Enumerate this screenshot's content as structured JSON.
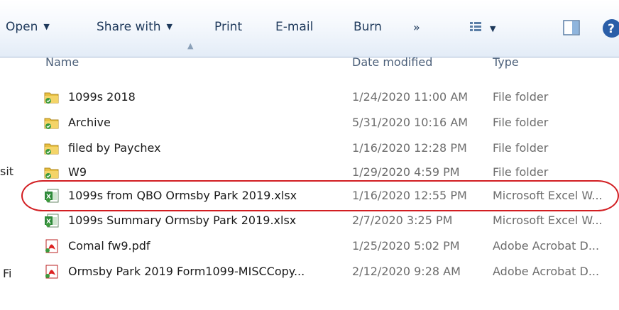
{
  "toolbar": {
    "open": "Open",
    "share": "Share with",
    "print": "Print",
    "email": "E-mail",
    "burn": "Burn",
    "more": "»"
  },
  "nav": {
    "frag1": "sit",
    "frag2": "Fi"
  },
  "columns": {
    "name": "Name",
    "date": "Date modified",
    "type": "Type"
  },
  "files": [
    {
      "name": "1099s 2018",
      "date": "1/24/2020 11:00 AM",
      "type": "File folder",
      "icon": "folder-icon"
    },
    {
      "name": "Archive",
      "date": "5/31/2020 10:16 AM",
      "type": "File folder",
      "icon": "folder-icon"
    },
    {
      "name": "filed by Paychex",
      "date": "1/16/2020 12:28 PM",
      "type": "File folder",
      "icon": "folder-icon"
    },
    {
      "name": "W9",
      "date": "1/29/2020 4:59 PM",
      "type": "File folder",
      "icon": "folder-icon"
    },
    {
      "name": "1099s from QBO Ormsby Park 2019.xlsx",
      "date": "1/16/2020 12:55 PM",
      "type": "Microsoft Excel W...",
      "icon": "excel-icon"
    },
    {
      "name": "1099s Summary Ormsby Park 2019.xlsx",
      "date": "2/7/2020 3:25 PM",
      "type": "Microsoft Excel W...",
      "icon": "excel-icon"
    },
    {
      "name": "Comal fw9.pdf",
      "date": "1/25/2020 5:02 PM",
      "type": "Adobe Acrobat D...",
      "icon": "pdf-icon"
    },
    {
      "name": "Ormsby Park 2019 Form1099-MISCCopy...",
      "date": "2/12/2020 9:28 AM",
      "type": "Adobe Acrobat D...",
      "icon": "pdf-icon"
    }
  ]
}
